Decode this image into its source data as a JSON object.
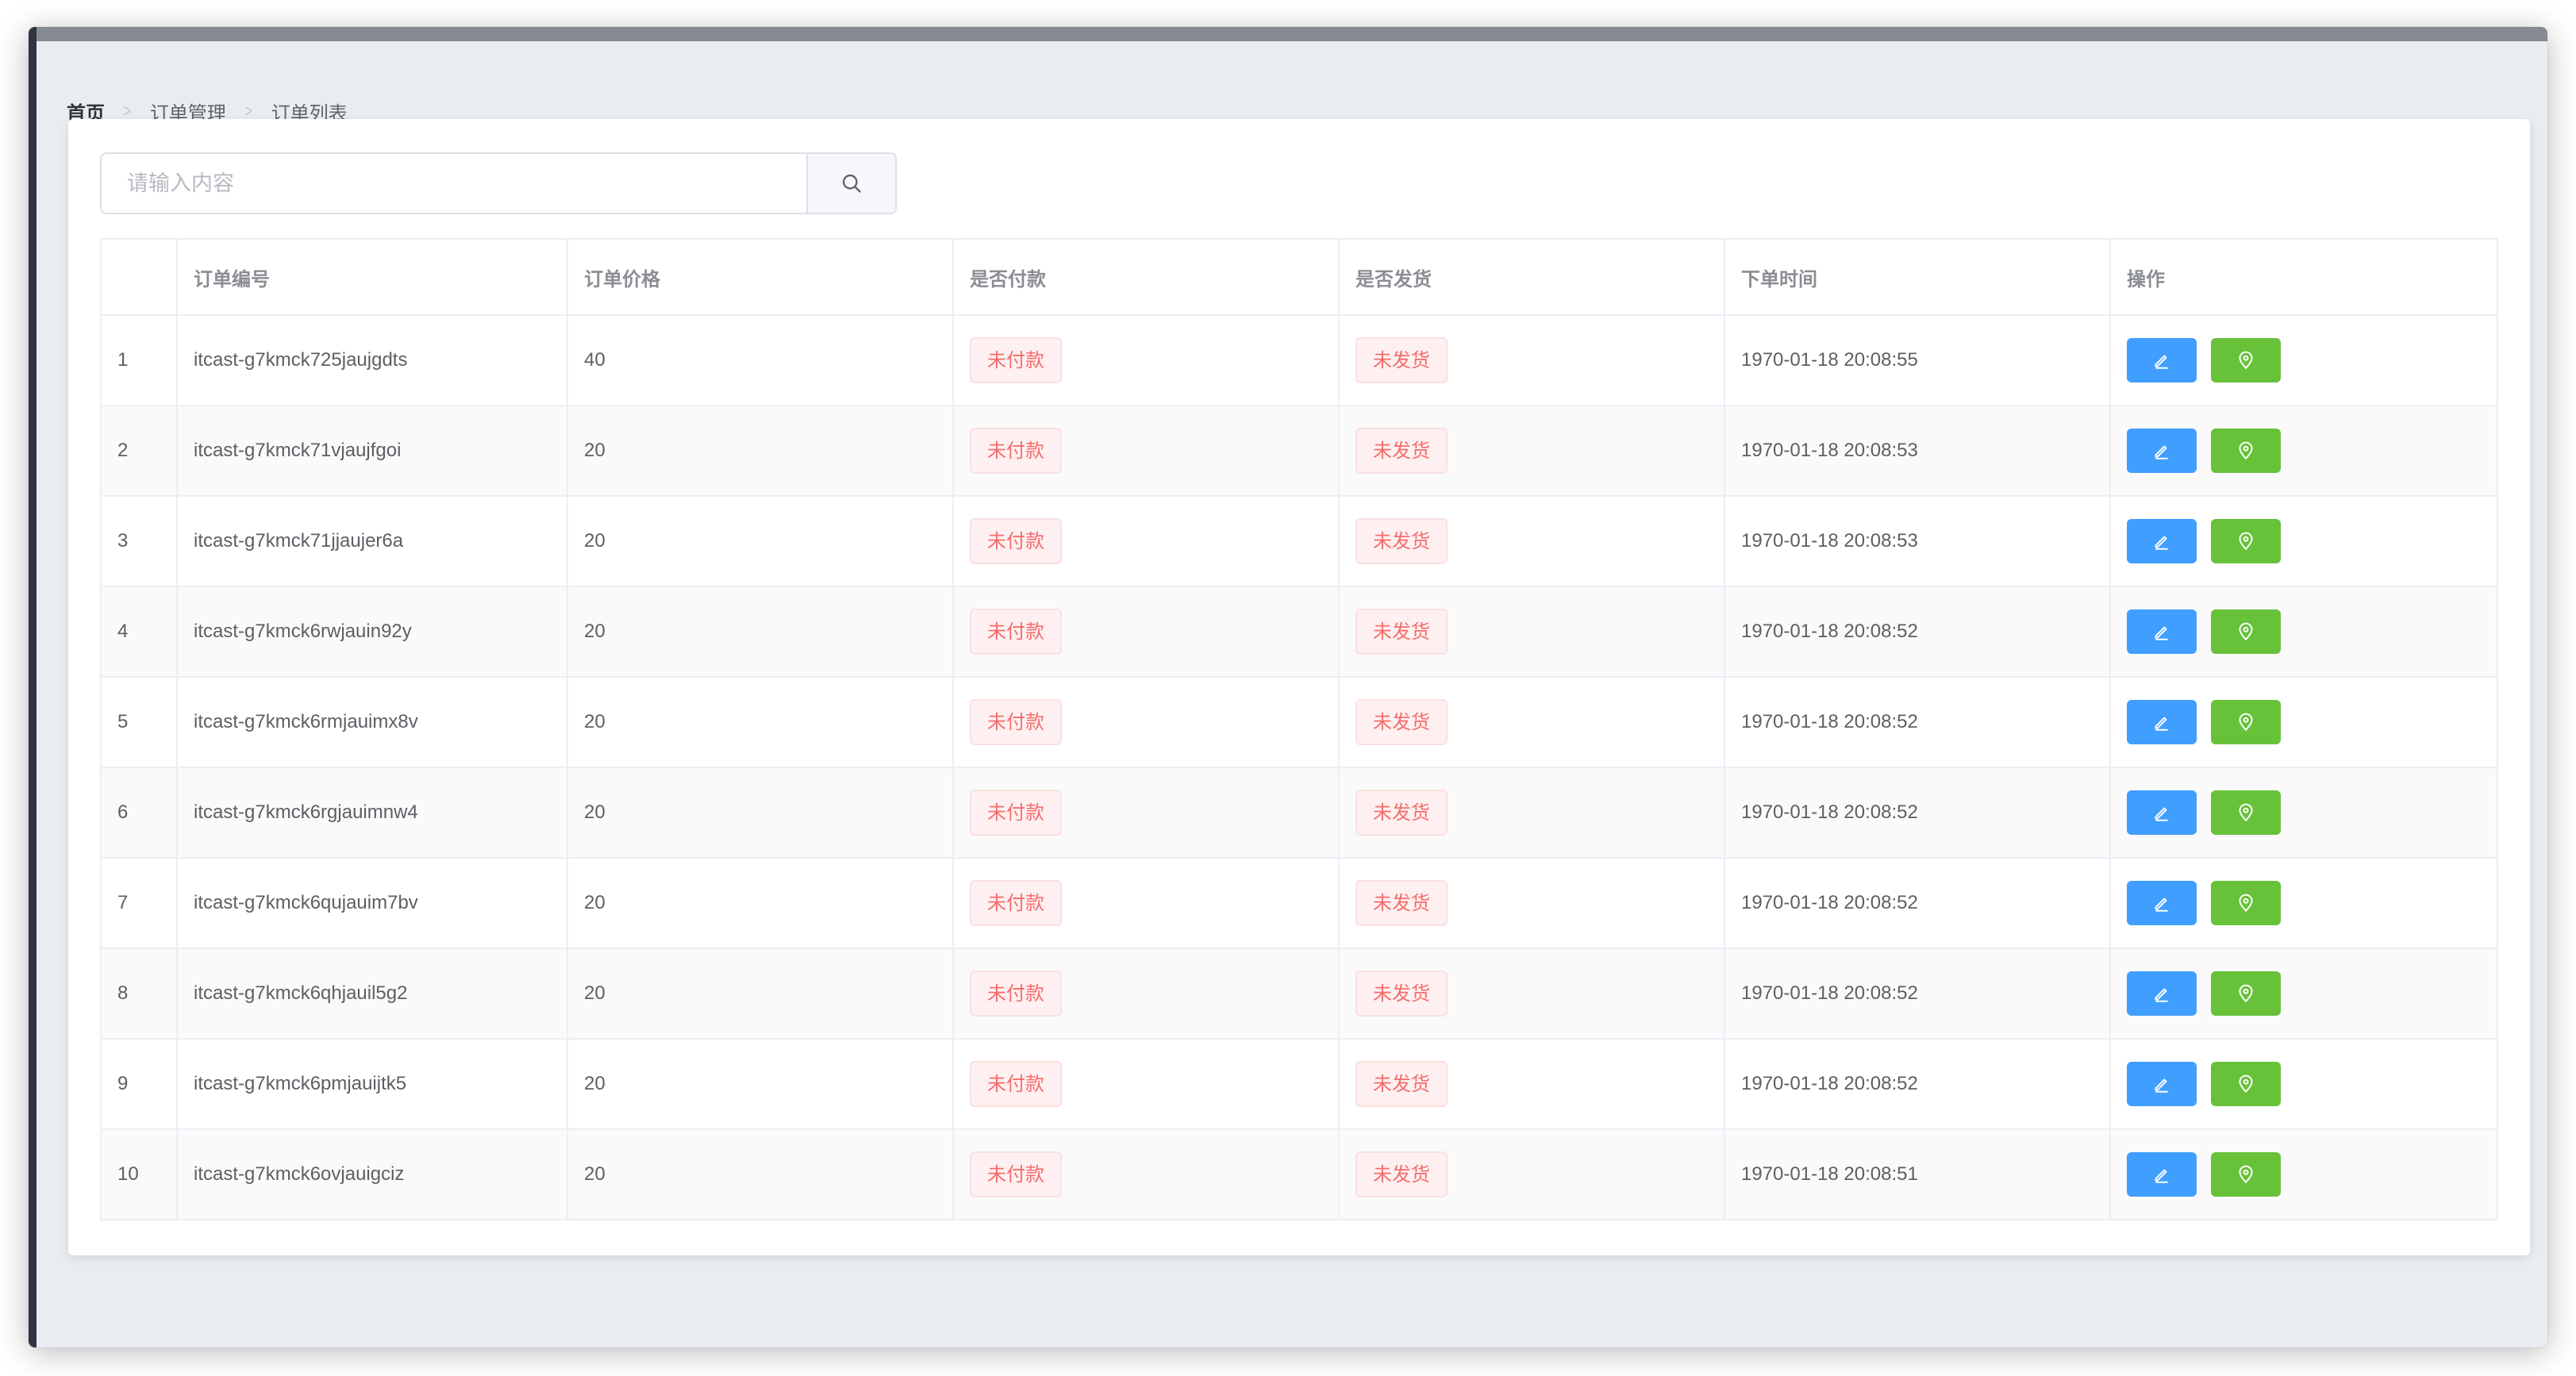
{
  "breadcrumb": {
    "home": "首页",
    "level2": "订单管理",
    "level3": "订单列表"
  },
  "search": {
    "placeholder": "请输入内容",
    "value": ""
  },
  "table": {
    "columns": [
      "",
      "订单编号",
      "订单价格",
      "是否付款",
      "是否发货",
      "下单时间",
      "操作"
    ],
    "rows": [
      {
        "index": "1",
        "order_no": "itcast-g7kmck725jaujgdts",
        "price": "40",
        "paid": "未付款",
        "shipped": "未发货",
        "time": "1970-01-18 20:08:55"
      },
      {
        "index": "2",
        "order_no": "itcast-g7kmck71vjaujfgoi",
        "price": "20",
        "paid": "未付款",
        "shipped": "未发货",
        "time": "1970-01-18 20:08:53"
      },
      {
        "index": "3",
        "order_no": "itcast-g7kmck71jjaujer6a",
        "price": "20",
        "paid": "未付款",
        "shipped": "未发货",
        "time": "1970-01-18 20:08:53"
      },
      {
        "index": "4",
        "order_no": "itcast-g7kmck6rwjauin92y",
        "price": "20",
        "paid": "未付款",
        "shipped": "未发货",
        "time": "1970-01-18 20:08:52"
      },
      {
        "index": "5",
        "order_no": "itcast-g7kmck6rmjauimx8v",
        "price": "20",
        "paid": "未付款",
        "shipped": "未发货",
        "time": "1970-01-18 20:08:52"
      },
      {
        "index": "6",
        "order_no": "itcast-g7kmck6rgjauimnw4",
        "price": "20",
        "paid": "未付款",
        "shipped": "未发货",
        "time": "1970-01-18 20:08:52"
      },
      {
        "index": "7",
        "order_no": "itcast-g7kmck6qujauim7bv",
        "price": "20",
        "paid": "未付款",
        "shipped": "未发货",
        "time": "1970-01-18 20:08:52"
      },
      {
        "index": "8",
        "order_no": "itcast-g7kmck6qhjauil5g2",
        "price": "20",
        "paid": "未付款",
        "shipped": "未发货",
        "time": "1970-01-18 20:08:52"
      },
      {
        "index": "9",
        "order_no": "itcast-g7kmck6pmjauijtk5",
        "price": "20",
        "paid": "未付款",
        "shipped": "未发货",
        "time": "1970-01-18 20:08:52"
      },
      {
        "index": "10",
        "order_no": "itcast-g7kmck6ovjauigciz",
        "price": "20",
        "paid": "未付款",
        "shipped": "未发货",
        "time": "1970-01-18 20:08:51"
      }
    ]
  },
  "icons": {
    "search": "search-icon",
    "edit": "edit-icon",
    "location": "location-icon"
  },
  "colors": {
    "edit_button": "#409eff",
    "location_button": "#67c23a",
    "danger_tag_text": "#f56c6c",
    "danger_tag_bg": "#fef0f0"
  }
}
